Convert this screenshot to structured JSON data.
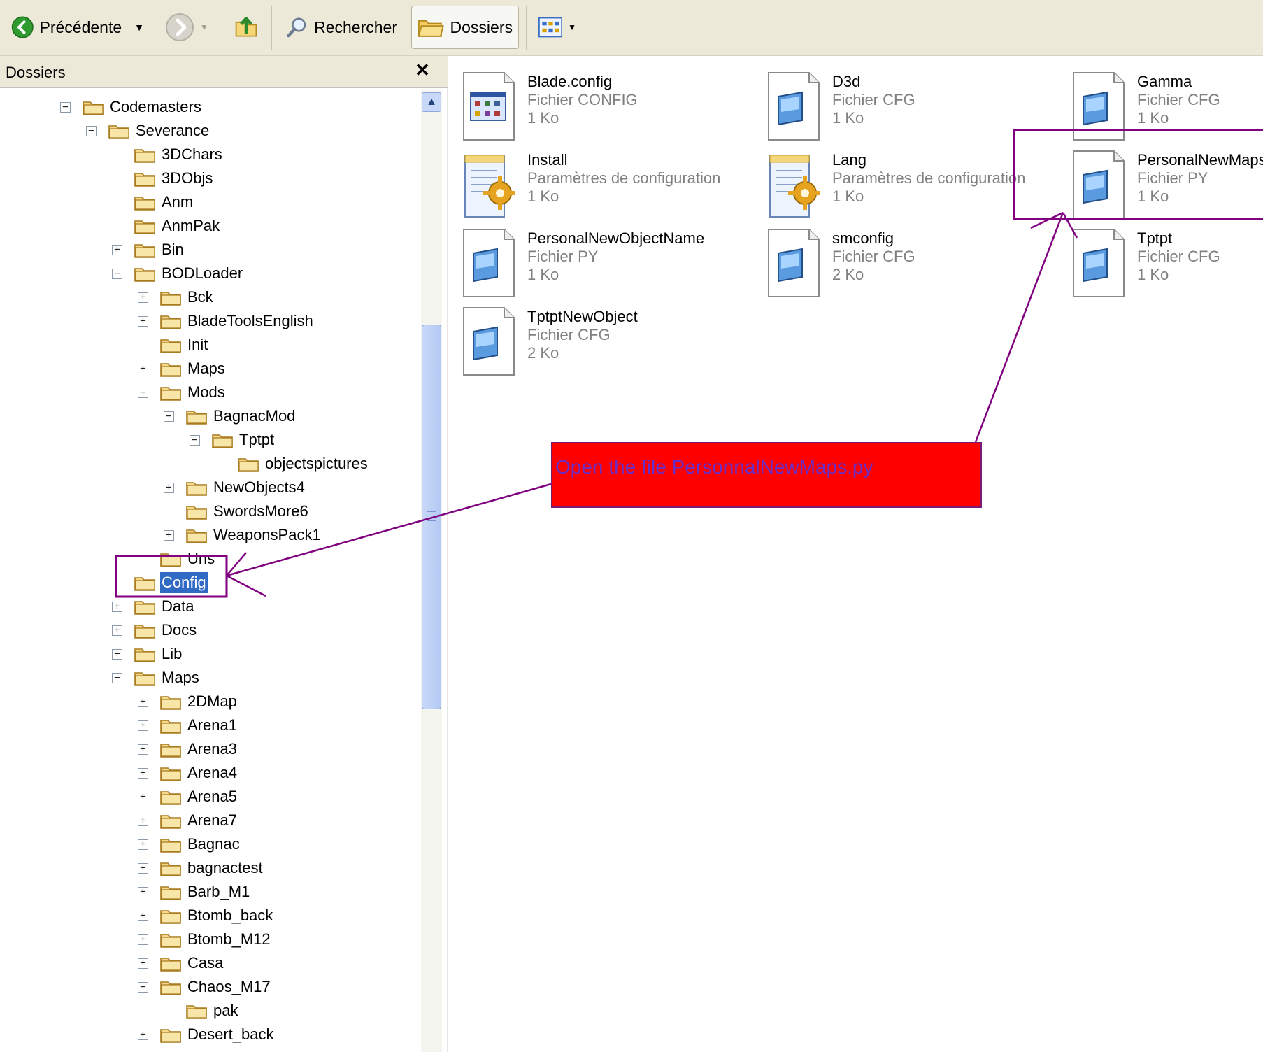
{
  "toolbar": {
    "back_label": "Précédente",
    "search_label": "Rechercher",
    "folders_label": "Dossiers"
  },
  "left_pane": {
    "title": "Dossiers",
    "close_glyph": "✕",
    "tree": [
      {
        "label": "Codemasters",
        "expander": "minus"
      },
      {
        "label": "Severance",
        "expander": "minus"
      },
      {
        "label": "3DChars",
        "expander": "none"
      },
      {
        "label": "3DObjs",
        "expander": "none"
      },
      {
        "label": "Anm",
        "expander": "none"
      },
      {
        "label": "AnmPak",
        "expander": "none"
      },
      {
        "label": "Bin",
        "expander": "plus"
      },
      {
        "label": "BODLoader",
        "expander": "minus"
      },
      {
        "label": "Bck",
        "expander": "plus"
      },
      {
        "label": "BladeToolsEnglish",
        "expander": "plus"
      },
      {
        "label": "Init",
        "expander": "none"
      },
      {
        "label": "Maps",
        "expander": "plus"
      },
      {
        "label": "Mods",
        "expander": "minus"
      },
      {
        "label": "BagnacMod",
        "expander": "minus"
      },
      {
        "label": "Tptpt",
        "expander": "minus"
      },
      {
        "label": "objectspictures",
        "expander": "none"
      },
      {
        "label": "NewObjects4",
        "expander": "plus"
      },
      {
        "label": "SwordsMore6",
        "expander": "none"
      },
      {
        "label": "WeaponsPack1",
        "expander": "plus"
      },
      {
        "label": "Uns",
        "expander": "none"
      },
      {
        "label": "Config",
        "expander": "none",
        "selected": true
      },
      {
        "label": "Data",
        "expander": "plus"
      },
      {
        "label": "Docs",
        "expander": "plus"
      },
      {
        "label": "Lib",
        "expander": "plus"
      },
      {
        "label": "Maps",
        "expander": "minus"
      },
      {
        "label": "2DMap",
        "expander": "plus"
      },
      {
        "label": "Arena1",
        "expander": "plus"
      },
      {
        "label": "Arena3",
        "expander": "plus"
      },
      {
        "label": "Arena4",
        "expander": "plus"
      },
      {
        "label": "Arena5",
        "expander": "plus"
      },
      {
        "label": "Arena7",
        "expander": "plus"
      },
      {
        "label": "Bagnac",
        "expander": "plus"
      },
      {
        "label": "bagnactest",
        "expander": "plus"
      },
      {
        "label": "Barb_M1",
        "expander": "plus"
      },
      {
        "label": "Btomb_back",
        "expander": "plus"
      },
      {
        "label": "Btomb_M12",
        "expander": "plus"
      },
      {
        "label": "Casa",
        "expander": "plus"
      },
      {
        "label": "Chaos_M17",
        "expander": "minus"
      },
      {
        "label": "pak",
        "expander": "none"
      },
      {
        "label": "Desert_back",
        "expander": "plus"
      }
    ]
  },
  "files": [
    {
      "name": "Blade.config",
      "type": "Fichier CONFIG",
      "size": "1 Ko",
      "icon": "config-app-icon"
    },
    {
      "name": "D3d",
      "type": "Fichier CFG",
      "size": "1 Ko",
      "icon": "cfg-file-icon"
    },
    {
      "name": "Gamma",
      "type": "Fichier CFG",
      "size": "1 Ko",
      "icon": "cfg-file-icon"
    },
    {
      "name": "Install",
      "type": "Paramètres de configuration",
      "size": "1 Ko",
      "icon": "settings-file-icon"
    },
    {
      "name": "Lang",
      "type": "Paramètres de configuration",
      "size": "1 Ko",
      "icon": "settings-file-icon"
    },
    {
      "name": "PersonalNewMaps",
      "type": "Fichier PY",
      "size": "1 Ko",
      "icon": "py-file-icon"
    },
    {
      "name": "PersonalNewObjectName",
      "type": "Fichier PY",
      "size": "1 Ko",
      "icon": "py-file-icon"
    },
    {
      "name": "smconfig",
      "type": "Fichier CFG",
      "size": "2 Ko",
      "icon": "cfg-file-icon"
    },
    {
      "name": "Tptpt",
      "type": "Fichier CFG",
      "size": "1 Ko",
      "icon": "cfg-file-icon"
    },
    {
      "name": "TptptNewObject",
      "type": "Fichier CFG",
      "size": "2 Ko",
      "icon": "cfg-file-icon"
    }
  ],
  "annotation": {
    "callout_text": "Open the file PersonnalNewMaps.py",
    "fill_color": "#ff0000",
    "line_color": "#800080",
    "text_color": "#6a2fc8"
  }
}
